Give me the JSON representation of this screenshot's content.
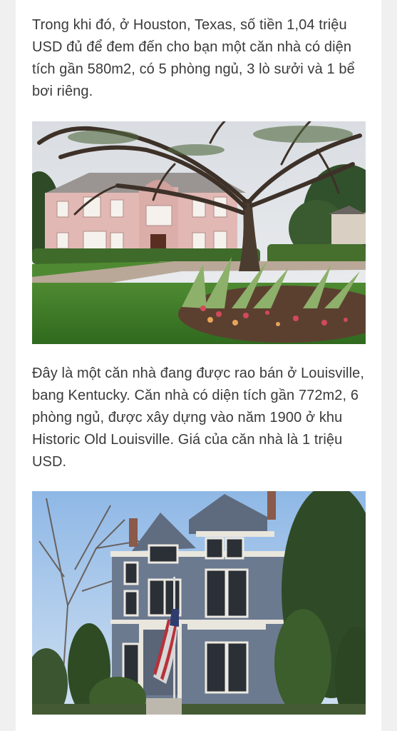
{
  "article": {
    "paragraph_1": "Trong khi đó, ở Houston, Texas, số tiền 1,04 triệu USD đủ để đem đến cho bạn một căn nhà có diện tích gần 580m2, có 5 phòng ngủ, 3 lò sưởi và 1 bể bơi riêng.",
    "paragraph_2": "Đây là một căn nhà đang được rao bán ở Louisville, bang Kentucky. Căn nhà có diện tích gần 772m2, 6 phòng ngủ, được xây dựng vào năm 1900 ở khu Historic Old Louisville. Giá của căn nhà là 1 triệu USD."
  }
}
